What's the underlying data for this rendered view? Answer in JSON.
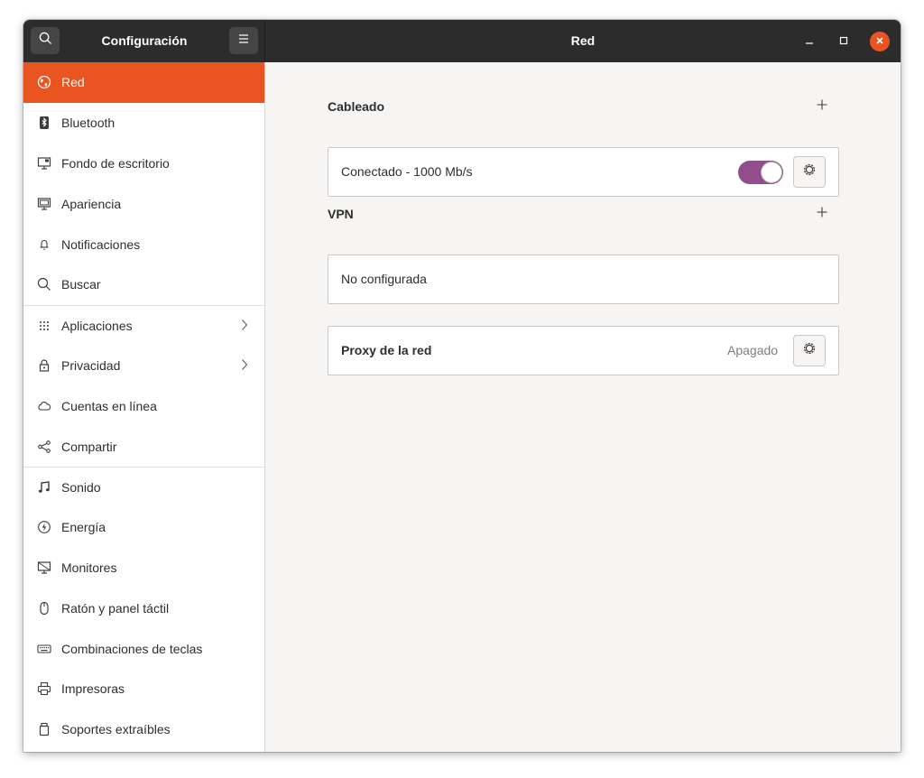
{
  "header": {
    "sidebar_title": "Configuración",
    "main_title": "Red"
  },
  "sidebar": {
    "items": [
      {
        "label": "Red",
        "icon": "network-globe-icon"
      },
      {
        "label": "Bluetooth",
        "icon": "bluetooth-icon"
      },
      {
        "label": "Fondo de escritorio",
        "icon": "wallpaper-icon"
      },
      {
        "label": "Apariencia",
        "icon": "appearance-icon"
      },
      {
        "label": "Notificaciones",
        "icon": "bell-icon"
      },
      {
        "label": "Buscar",
        "icon": "search-icon"
      },
      {
        "label": "Aplicaciones",
        "icon": "apps-grid-icon"
      },
      {
        "label": "Privacidad",
        "icon": "lock-icon"
      },
      {
        "label": "Cuentas en línea",
        "icon": "cloud-icon"
      },
      {
        "label": "Compartir",
        "icon": "share-icon"
      },
      {
        "label": "Sonido",
        "icon": "music-note-icon"
      },
      {
        "label": "Energía",
        "icon": "power-icon"
      },
      {
        "label": "Monitores",
        "icon": "monitor-icon"
      },
      {
        "label": "Ratón y panel táctil",
        "icon": "mouse-icon"
      },
      {
        "label": "Combinaciones de teclas",
        "icon": "keyboard-icon"
      },
      {
        "label": "Impresoras",
        "icon": "printer-icon"
      },
      {
        "label": "Soportes extraíbles",
        "icon": "removable-media-icon"
      }
    ],
    "selected": "Red"
  },
  "main": {
    "wired": {
      "title": "Cableado",
      "connection_label": "Conectado - 1000 Mb/s",
      "toggle_on": true
    },
    "vpn": {
      "title": "VPN",
      "status_label": "No configurada"
    },
    "proxy": {
      "label": "Proxy de la red",
      "status": "Apagado"
    }
  },
  "colors": {
    "accent": "#e95420",
    "toggle": "#924d8b",
    "titlebar": "#2c2c2c"
  }
}
